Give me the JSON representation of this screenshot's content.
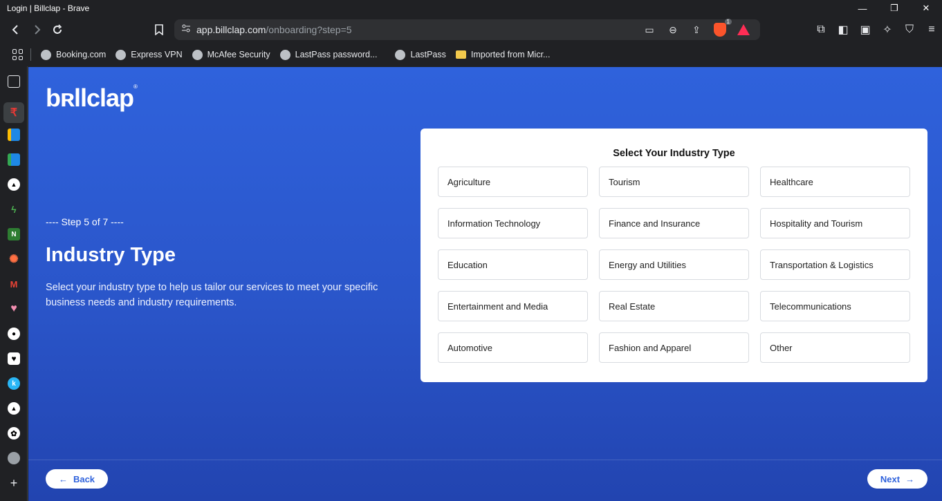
{
  "window": {
    "title": "Login | Billclap - Brave"
  },
  "address_bar": {
    "host": "app.billclap.com",
    "path": "/onboarding?step=5",
    "shield_count": "1"
  },
  "bookmarks": [
    {
      "label": "Booking.com",
      "icon": "globe-icon"
    },
    {
      "label": "Express VPN",
      "icon": "globe-icon"
    },
    {
      "label": "McAfee Security",
      "icon": "globe-icon"
    },
    {
      "label": "LastPass password...",
      "icon": "globe-icon"
    },
    {
      "label": "LastPass",
      "icon": "globe-icon"
    },
    {
      "label": "Imported from Micr...",
      "icon": "folder-icon"
    }
  ],
  "app": {
    "logo": "bʀllclap",
    "step_text": "---- Step 5 of 7 ----",
    "heading": "Industry Type",
    "description": "Select your industry type to help us tailor our services to meet your specific business needs and industry requirements.",
    "card_title": "Select Your Industry Type",
    "options": [
      "Agriculture",
      "Tourism",
      "Healthcare",
      "Information Technology",
      "Finance and Insurance",
      "Hospitality and Tourism",
      "Education",
      "Energy and Utilities",
      "Transportation & Logistics",
      "Entertainment and Media",
      "Real Estate",
      "Telecommunications",
      "Automotive",
      "Fashion and Apparel",
      "Other"
    ],
    "back_label": "Back",
    "next_label": "Next"
  },
  "colors": {
    "primary": "#2f62dc",
    "card_bg": "#ffffff",
    "brave_orange": "#fb542b"
  }
}
